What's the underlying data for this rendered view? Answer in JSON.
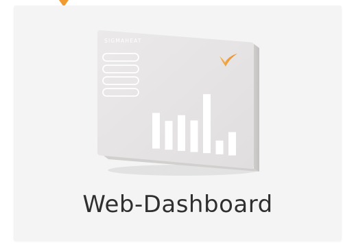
{
  "device": {
    "brand": "SIGMAHEAT",
    "bars": [
      0.52,
      0.42,
      0.52,
      0.46,
      0.86,
      0.2,
      0.34
    ],
    "accent": "#f09a32",
    "body_color": "#e6e4e4"
  },
  "card": {
    "title": "Web-Dashboard"
  },
  "icons": {
    "pointer": "caret-down-icon",
    "logo": "checkmark-logo-icon"
  }
}
